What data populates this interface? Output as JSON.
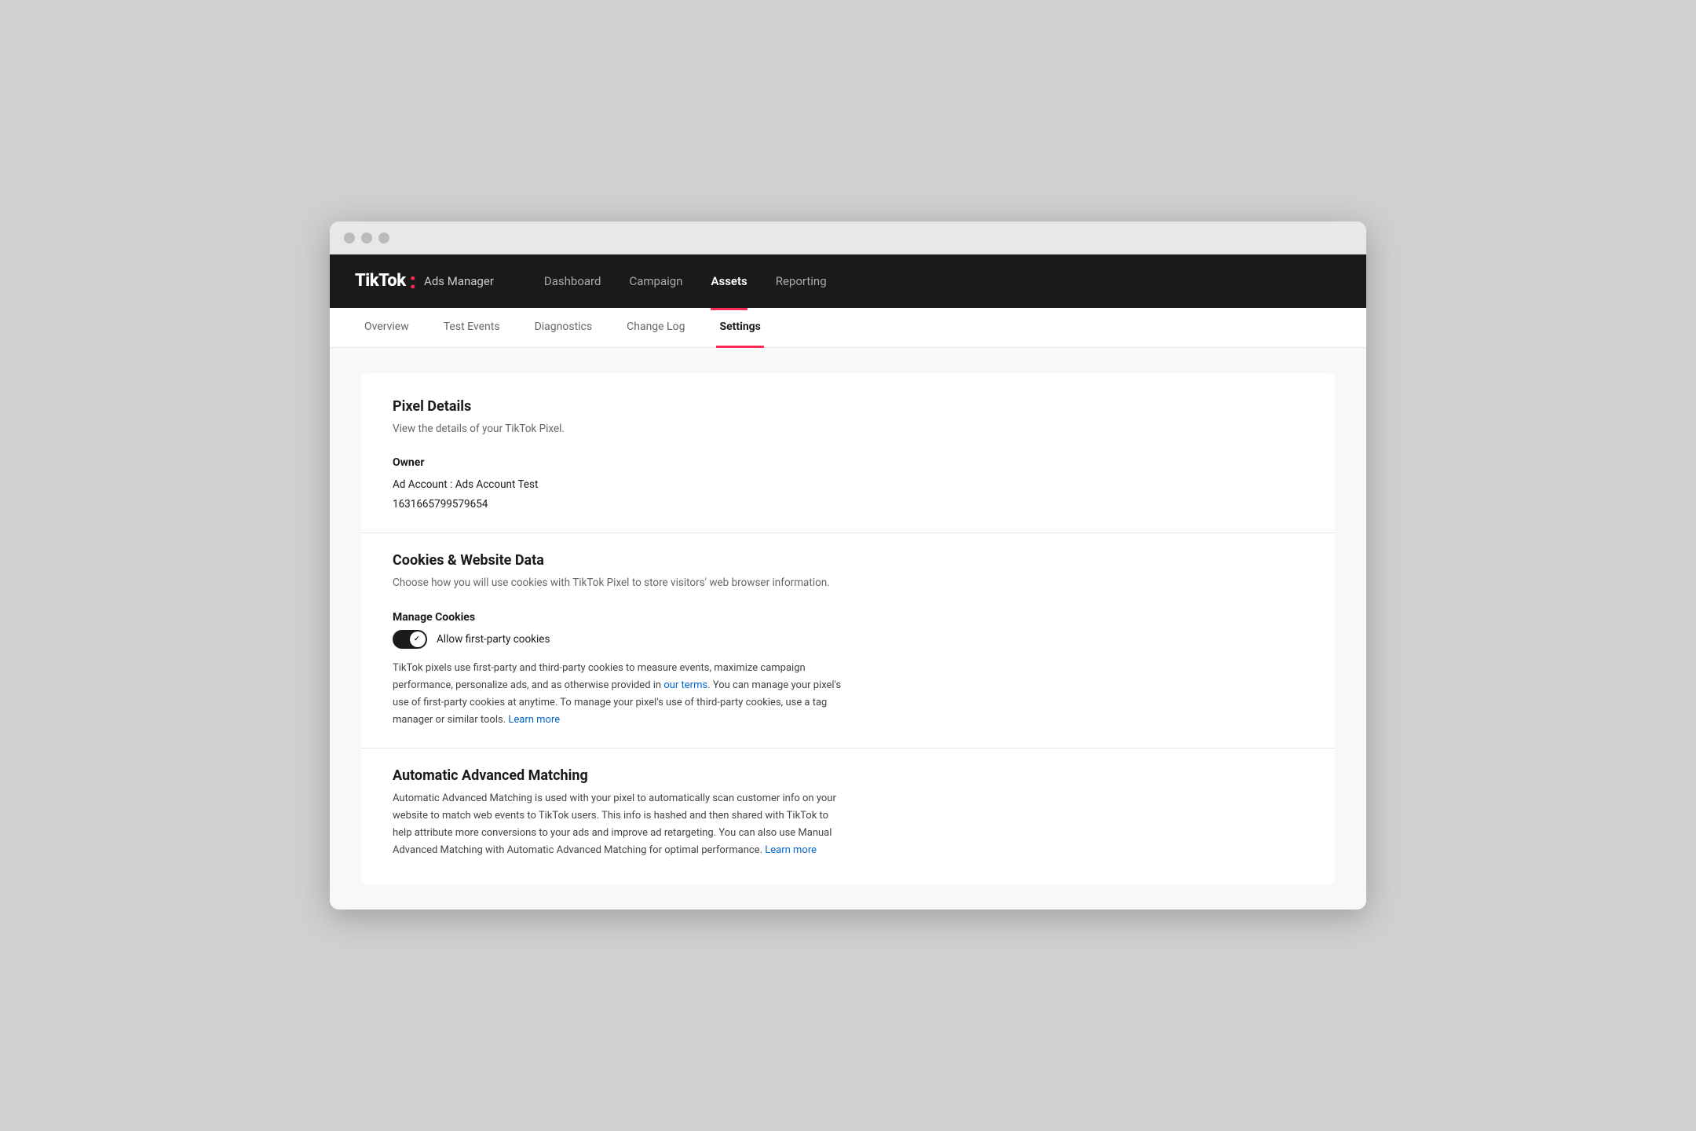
{
  "browser": {
    "dots": [
      "dot1",
      "dot2",
      "dot3"
    ]
  },
  "topNav": {
    "logo": {
      "brand": "TikTok",
      "dot": ":",
      "subtitle": "Ads Manager"
    },
    "items": [
      {
        "id": "dashboard",
        "label": "Dashboard",
        "active": false
      },
      {
        "id": "campaign",
        "label": "Campaign",
        "active": false
      },
      {
        "id": "assets",
        "label": "Assets",
        "active": true
      },
      {
        "id": "reporting",
        "label": "Reporting",
        "active": false
      }
    ]
  },
  "subNav": {
    "items": [
      {
        "id": "overview",
        "label": "Overview",
        "active": false
      },
      {
        "id": "test-events",
        "label": "Test Events",
        "active": false
      },
      {
        "id": "diagnostics",
        "label": "Diagnostics",
        "active": false
      },
      {
        "id": "change-log",
        "label": "Change Log",
        "active": false
      },
      {
        "id": "settings",
        "label": "Settings",
        "active": true
      }
    ]
  },
  "pixelDetails": {
    "title": "Pixel Details",
    "description": "View the details of your TikTok Pixel.",
    "ownerLabel": "Owner",
    "ownerValue": "Ad Account : Ads Account Test",
    "pixelId": "1631665799579654"
  },
  "cookiesSection": {
    "title": "Cookies & Website Data",
    "description": "Choose how you will use cookies with TikTok Pixel to store visitors' web browser information.",
    "manageCookiesLabel": "Manage Cookies",
    "toggleLabel": "Allow first-party cookies",
    "toggleEnabled": true,
    "cookieDesc1": "TikTok pixels use first-party and third-party cookies to measure events, maximize campaign performance, personalize ads, and as otherwise provided in ",
    "ourTermsText": "our terms",
    "cookieDesc2": ". You can manage your pixel's use of first-party cookies at anytime. To manage your pixel's use of third-party cookies, use a tag manager or similar tools.",
    "learnMoreText": "Learn more"
  },
  "automaticMatching": {
    "title": "Automatic Advanced Matching",
    "description": "Automatic Advanced Matching is used with your pixel to automatically scan customer info on your website to match web events to TikTok users. This info is hashed and then shared with TikTok to help attribute more conversions to your ads and improve ad retargeting. You can also use Manual Advanced Matching with Automatic Advanced Matching for optimal performance.",
    "learnMoreText": "Learn more"
  }
}
